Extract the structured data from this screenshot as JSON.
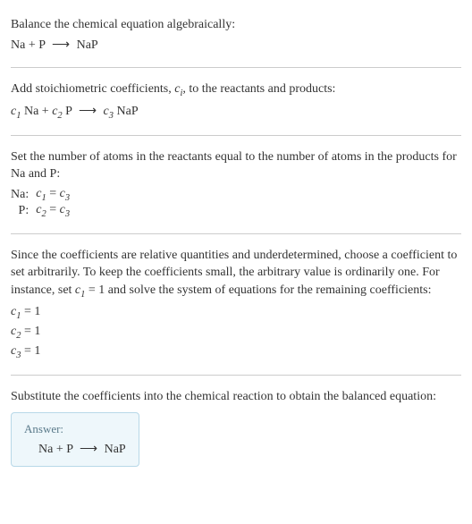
{
  "intro": {
    "title": "Balance the chemical equation algebraically:",
    "reactant1": "Na",
    "plus": " + ",
    "reactant2": "P",
    "arrow": "⟶",
    "product": "NaP"
  },
  "step1": {
    "text_before": "Add stoichiometric coefficients, ",
    "ci": "c",
    "ci_sub": "i",
    "text_after": ", to the reactants and products:",
    "c1": "c",
    "c1_sub": "1",
    "r1": " Na + ",
    "c2": "c",
    "c2_sub": "2",
    "r2": " P ",
    "arrow": "⟶",
    "sp": " ",
    "c3": "c",
    "c3_sub": "3",
    "r3": " NaP"
  },
  "step2": {
    "text": "Set the number of atoms in the reactants equal to the number of atoms in the products for Na and P:",
    "rows": [
      {
        "label": "Na:",
        "lhs_c": "c",
        "lhs_s": "1",
        "eq": " = ",
        "rhs_c": "c",
        "rhs_s": "3"
      },
      {
        "label": "P:",
        "lhs_c": "c",
        "lhs_s": "2",
        "eq": " = ",
        "rhs_c": "c",
        "rhs_s": "3"
      }
    ]
  },
  "step3": {
    "text_a": "Since the coefficients are relative quantities and underdetermined, choose a coefficient to set arbitrarily. To keep the coefficients small, the arbitrary value is ordinarily one. For instance, set ",
    "cv": "c",
    "cv_sub": "1",
    "text_b": " = 1 and solve the system of equations for the remaining coefficients:",
    "sol": [
      {
        "c": "c",
        "s": "1",
        "v": " = 1"
      },
      {
        "c": "c",
        "s": "2",
        "v": " = 1"
      },
      {
        "c": "c",
        "s": "3",
        "v": " = 1"
      }
    ]
  },
  "step4": {
    "text": "Substitute the coefficients into the chemical reaction to obtain the balanced equation:"
  },
  "answer": {
    "label": "Answer:",
    "r1": "Na + P ",
    "arrow": "⟶",
    "r2": " NaP"
  }
}
